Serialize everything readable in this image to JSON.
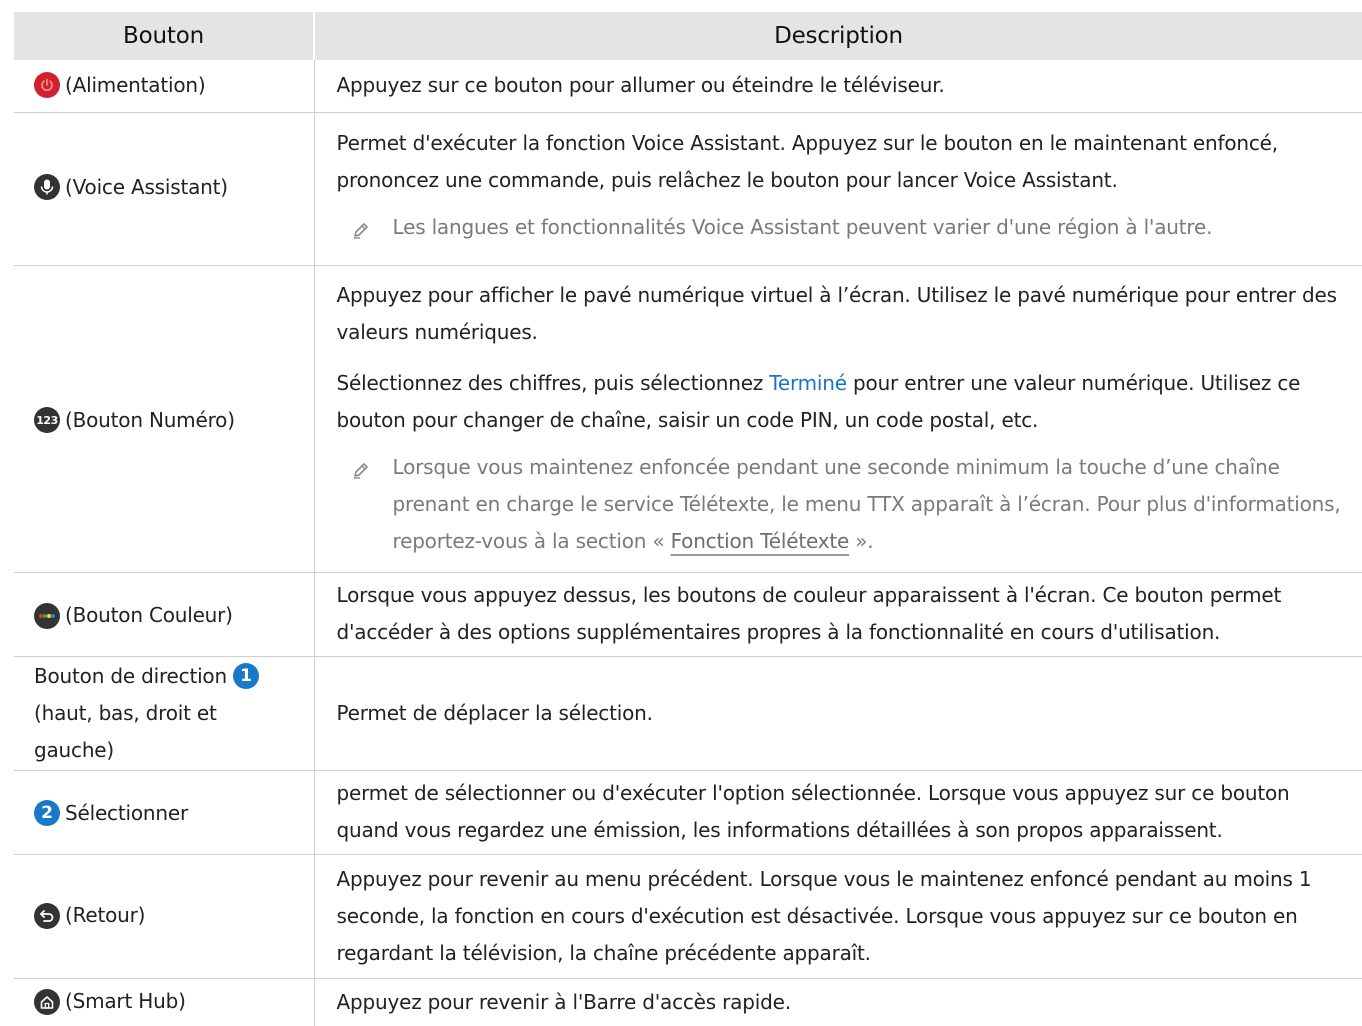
{
  "table": {
    "headers": {
      "button": "Bouton",
      "description": "Description"
    },
    "rows": [
      {
        "icon": "power-icon",
        "label": "(Alimentation)",
        "desc": "Appuyez sur ce bouton pour allumer ou éteindre le téléviseur."
      },
      {
        "icon": "microphone-icon",
        "label": "(Voice Assistant)",
        "desc": "Permet d'exécuter la fonction Voice Assistant. Appuyez sur le bouton en le maintenant enfoncé, prononcez une commande, puis relâchez le bouton pour lancer Voice Assistant.",
        "note": "Les langues et fonctionnalités Voice Assistant peuvent varier d'une région à l'autre."
      },
      {
        "icon": "number-pad-icon",
        "icon_text": "123",
        "label": "(Bouton Numéro)",
        "desc1": "Appuyez pour afficher le pavé numérique virtuel à l’écran. Utilisez le pavé numérique pour entrer des valeurs numériques.",
        "desc2_pre": "Sélectionnez des chiffres, puis sélectionnez ",
        "desc2_highlight": "Terminé",
        "desc2_post": " pour entrer une valeur numérique. Utilisez ce bouton pour changer de chaîne, saisir un code PIN, un code postal, etc.",
        "note_pre": "Lorsque vous maintenez enfoncée pendant une seconde minimum la touche d’une chaîne prenant en charge le service Télétexte, le menu TTX apparaît à l’écran. Pour plus d'informations, reportez-vous à la section « ",
        "note_link": "Fonction Télétexte",
        "note_post": " »."
      },
      {
        "icon": "color-dots-icon",
        "label": "(Bouton Couleur)",
        "desc": "Lorsque vous appuyez dessus, les boutons de couleur apparaissent à l'écran. Ce bouton permet d'accéder à des options supplémentaires propres à la fonctionnalité en cours d'utilisation."
      },
      {
        "icon": "number-one-icon",
        "icon_text": "1",
        "label_pre": "Bouton de direction",
        "label_post": "(haut, bas, droit et gauche)",
        "desc": "Permet de déplacer la sélection."
      },
      {
        "icon": "number-two-icon",
        "icon_text": "2",
        "label": "Sélectionner",
        "desc": "permet de sélectionner ou d'exécuter l'option sélectionnée. Lorsque vous appuyez sur ce bouton quand vous regardez une émission, les informations détaillées à son propos apparaissent."
      },
      {
        "icon": "return-arrow-icon",
        "label": "(Retour)",
        "desc": "Appuyez pour revenir au menu précédent. Lorsque vous le maintenez enfoncé pendant au moins 1 seconde, la fonction en cours d'exécution est désactivée. Lorsque vous appuyez sur ce bouton en regardant la télévision, la chaîne précédente apparaît."
      },
      {
        "icon": "home-icon",
        "label": "(Smart Hub)",
        "desc": "Appuyez pour revenir à l'Barre d'accès rapide."
      }
    ]
  },
  "colors": {
    "header_bg": "#e4e4e4",
    "power_red": "#d3202f",
    "icon_dark": "#333333",
    "accent_blue": "#1a78c9",
    "note_gray": "#7a7a7a"
  }
}
